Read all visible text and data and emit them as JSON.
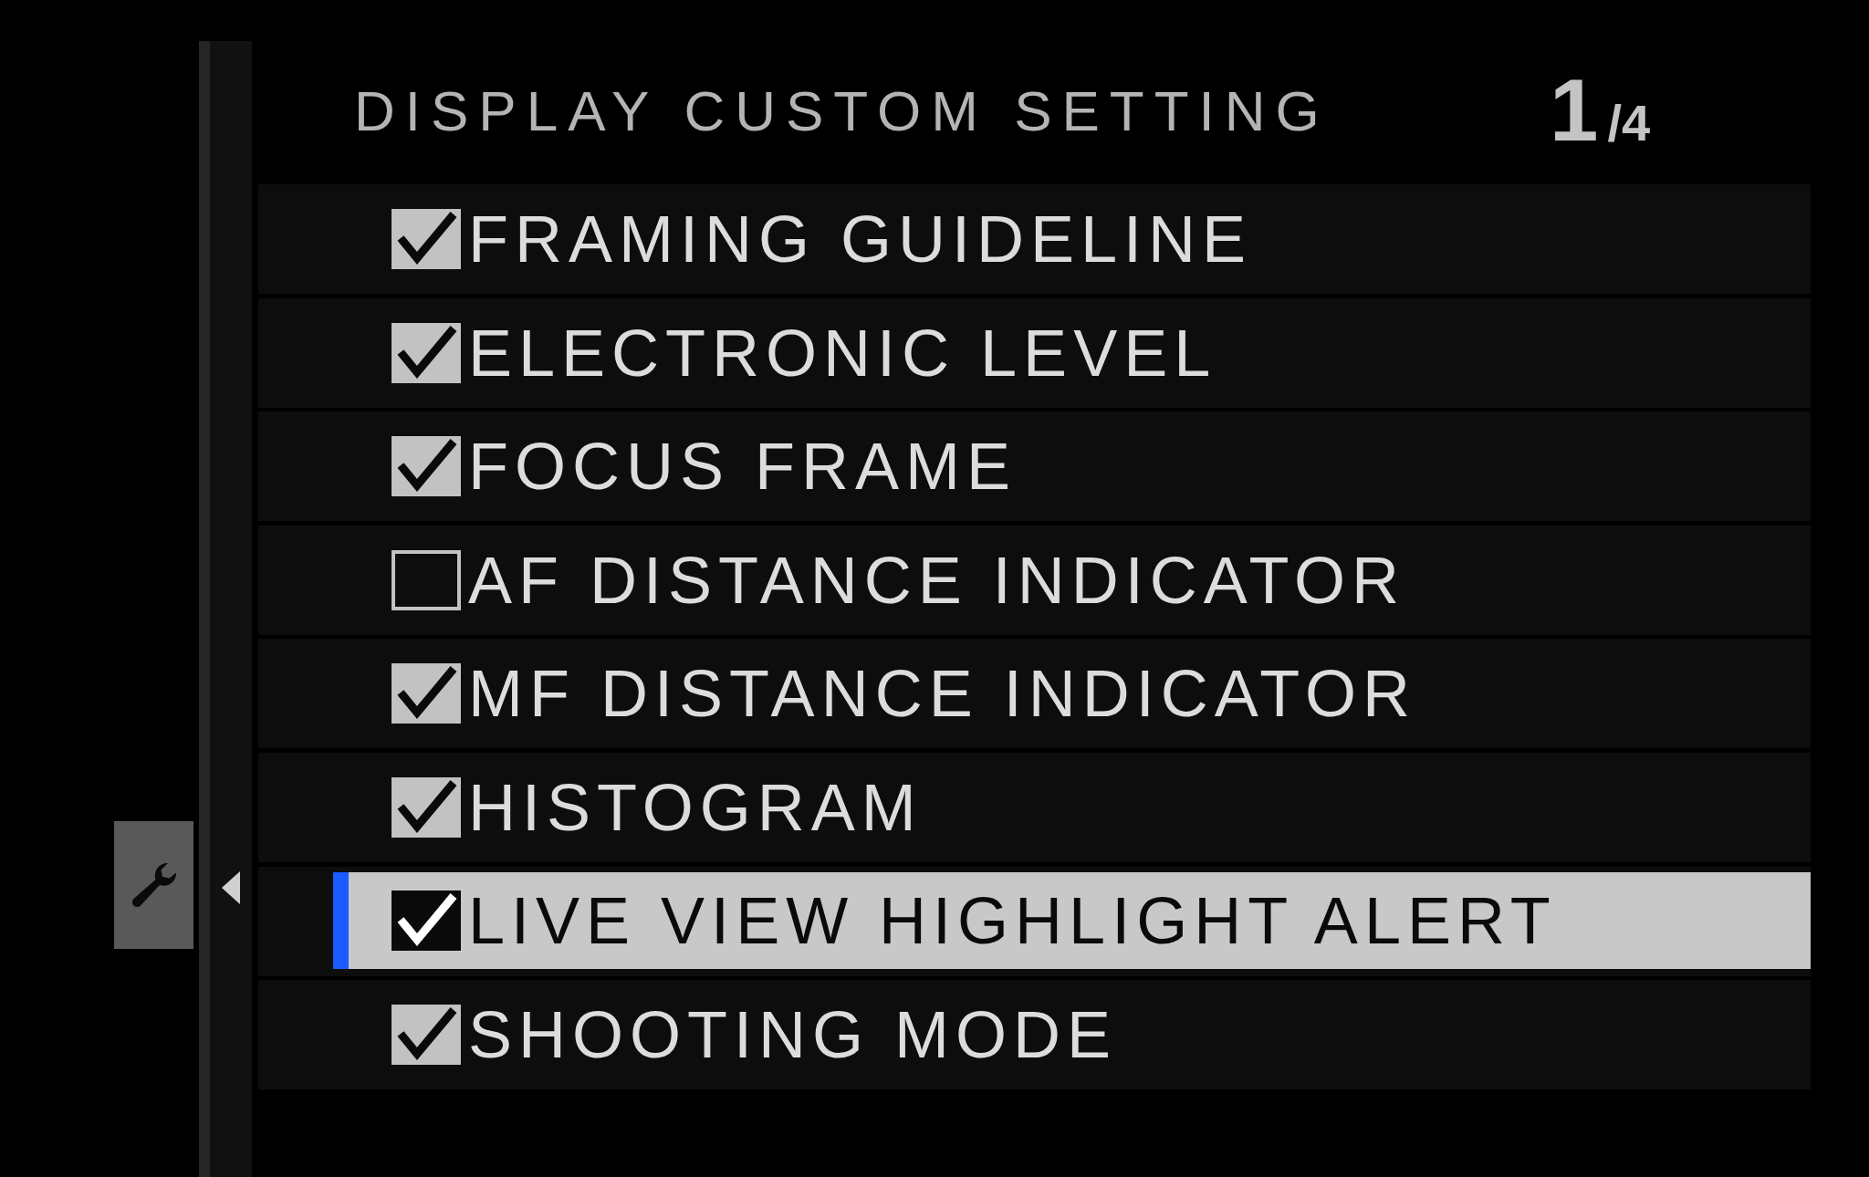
{
  "title": "DISPLAY CUSTOM SETTING",
  "page": {
    "current": "1",
    "total": "/4"
  },
  "items": [
    {
      "label": "FRAMING GUIDELINE",
      "checked": true,
      "selected": false
    },
    {
      "label": "ELECTRONIC LEVEL",
      "checked": true,
      "selected": false
    },
    {
      "label": "FOCUS FRAME",
      "checked": true,
      "selected": false
    },
    {
      "label": "AF DISTANCE INDICATOR",
      "checked": false,
      "selected": false
    },
    {
      "label": "MF DISTANCE INDICATOR",
      "checked": true,
      "selected": false
    },
    {
      "label": "HISTOGRAM",
      "checked": true,
      "selected": false
    },
    {
      "label": "LIVE VIEW HIGHLIGHT ALERT",
      "checked": true,
      "selected": true
    },
    {
      "label": "SHOOTING MODE",
      "checked": true,
      "selected": false
    }
  ]
}
